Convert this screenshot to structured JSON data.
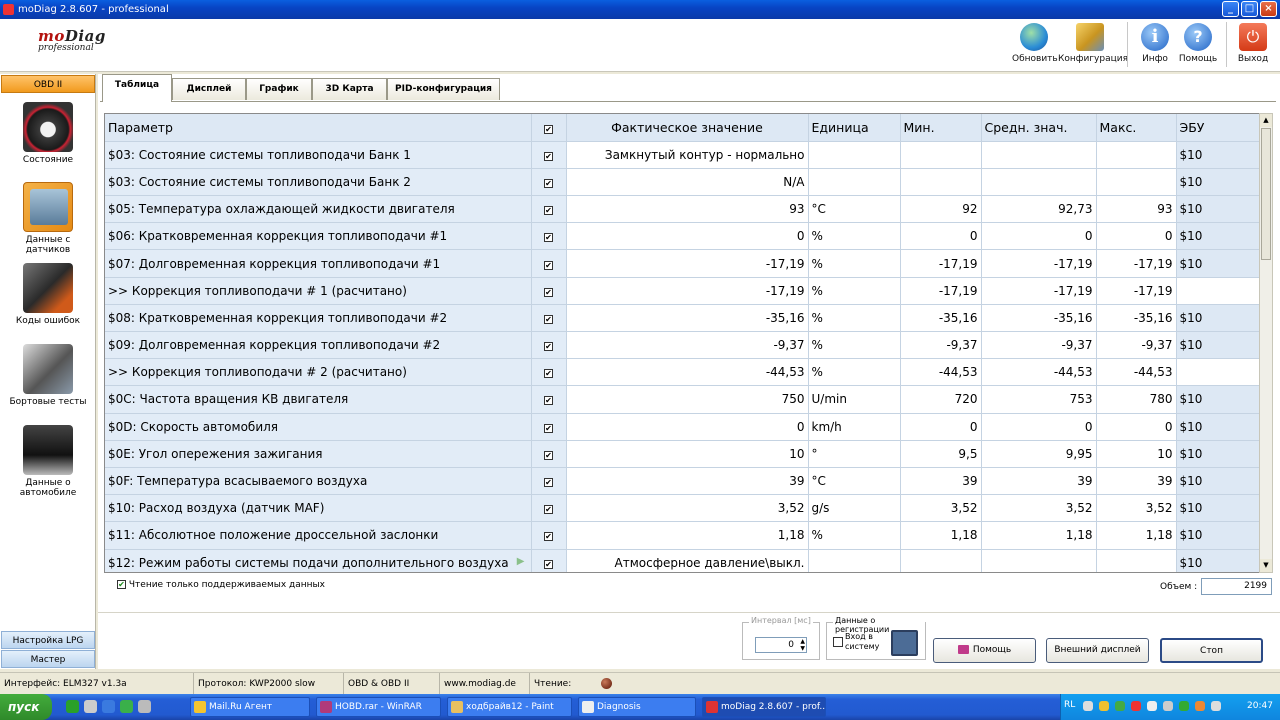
{
  "window": {
    "title": "moDiag 2.8.607 - professional",
    "min": "_",
    "max": "□",
    "close": "×"
  },
  "logo": {
    "brand_a": "mo",
    "brand_b": "Diag",
    "subtitle": "professional"
  },
  "toolbar": [
    {
      "label": "Обновить",
      "icon": "refresh-globe-icon"
    },
    {
      "label": "Конфигурация",
      "icon": "configuration-icon"
    },
    {
      "label": "Инфо",
      "icon": "info-icon"
    },
    {
      "label": "Помощь",
      "icon": "help-icon"
    },
    {
      "label": "Выход",
      "icon": "exit-power-icon"
    }
  ],
  "sidebar": {
    "header": "OBD II",
    "items": [
      {
        "label": "Состояние"
      },
      {
        "label": "Данные с датчиков"
      },
      {
        "label": "Коды ошибок"
      },
      {
        "label": "Бортовые тесты"
      },
      {
        "label_line1": "Данные о",
        "label_line2": "автомобиле"
      }
    ],
    "bottom": [
      "Настройка LPG",
      "Мастер"
    ]
  },
  "tabs": [
    "Таблица",
    "Дисплей",
    "График",
    "3D Карта",
    "PID-конфигурация"
  ],
  "table": {
    "headers": {
      "param": "Параметр",
      "check": "✔",
      "actual": "Фактическое значение",
      "unit": "Единица",
      "min": "Мин.",
      "avg": "Средн. знач.",
      "max": "Макс.",
      "ecu": "ЭБУ"
    },
    "rows": [
      {
        "param": "$03: Состояние системы топливоподачи Банк 1",
        "actual": "Замкнутый контур - нормально",
        "unit": "",
        "min": "",
        "avg": "",
        "max": "",
        "ecu": "$10"
      },
      {
        "param": "$03: Состояние системы топливоподачи Банк 2",
        "actual": "N/A",
        "unit": "",
        "min": "",
        "avg": "",
        "max": "",
        "ecu": "$10"
      },
      {
        "param": "$05: Температура охлаждающей жидкости двигателя",
        "actual": "93",
        "unit": "°C",
        "min": "92",
        "avg": "92,73",
        "max": "93",
        "ecu": "$10"
      },
      {
        "param": "$06: Кратковременная коррекция топливоподачи #1",
        "actual": "0",
        "unit": "%",
        "min": "0",
        "avg": "0",
        "max": "0",
        "ecu": "$10"
      },
      {
        "param": "$07: Долговременная коррекция топливоподачи #1",
        "actual": "-17,19",
        "unit": "%",
        "min": "-17,19",
        "avg": "-17,19",
        "max": "-17,19",
        "ecu": "$10"
      },
      {
        "param": ">> Коррекция топливоподачи # 1 (расчитано)",
        "actual": "-17,19",
        "unit": "%",
        "min": "-17,19",
        "avg": "-17,19",
        "max": "-17,19",
        "ecu": ""
      },
      {
        "param": "$08: Кратковременная коррекция топливоподачи #2",
        "actual": "-35,16",
        "unit": "%",
        "min": "-35,16",
        "avg": "-35,16",
        "max": "-35,16",
        "ecu": "$10"
      },
      {
        "param": "$09: Долговременная коррекция топливоподачи #2",
        "actual": "-9,37",
        "unit": "%",
        "min": "-9,37",
        "avg": "-9,37",
        "max": "-9,37",
        "ecu": "$10"
      },
      {
        "param": ">> Коррекция топливоподачи # 2 (расчитано)",
        "actual": "-44,53",
        "unit": "%",
        "min": "-44,53",
        "avg": "-44,53",
        "max": "-44,53",
        "ecu": ""
      },
      {
        "param": "$0C: Частота вращения КВ двигателя",
        "actual": "750",
        "unit": "U/min",
        "min": "720",
        "avg": "753",
        "max": "780",
        "ecu": "$10"
      },
      {
        "param": "$0D: Скорость автомобиля",
        "actual": "0",
        "unit": "km/h",
        "min": "0",
        "avg": "0",
        "max": "0",
        "ecu": "$10"
      },
      {
        "param": "$0E: Угол опережения зажигания",
        "actual": "10",
        "unit": "°",
        "min": "9,5",
        "avg": "9,95",
        "max": "10",
        "ecu": "$10"
      },
      {
        "param": "$0F: Температура всасываемого воздуха",
        "actual": "39",
        "unit": "°C",
        "min": "39",
        "avg": "39",
        "max": "39",
        "ecu": "$10"
      },
      {
        "param": "$10: Расход воздуха (датчик MAF)",
        "actual": "3,52",
        "unit": "g/s",
        "min": "3,52",
        "avg": "3,52",
        "max": "3,52",
        "ecu": "$10"
      },
      {
        "param": "$11: Абсолютное положение дроссельной заслонки",
        "actual": "1,18",
        "unit": "%",
        "min": "1,18",
        "avg": "1,18",
        "max": "1,18",
        "ecu": "$10"
      },
      {
        "param": "$12: Режим работы системы подачи дополнительного воздуха",
        "actual": "Атмосферное давление\\выкл.",
        "unit": "",
        "min": "",
        "avg": "",
        "max": "",
        "ecu": "$10"
      }
    ]
  },
  "options": {
    "supported_only": "Чтение  только поддерживаемых данных",
    "volume_label": "Объем :",
    "volume_value": "2199"
  },
  "interval": {
    "label": "Интервал [мс]",
    "value": "0"
  },
  "registration": {
    "label": "Данные о регистрации",
    "login_line1": "Вход в",
    "login_line2": "систему"
  },
  "buttons": {
    "help": "Помощь",
    "external": "Внешний дисплей",
    "stop": "Стоп"
  },
  "status": {
    "interface": "Интерфейс: ELM327 v1.3a",
    "protocol": "Протокол: KWP2000 slow",
    "mode": "OBD & OBD II",
    "site": "www.modiag.de",
    "reading": "Чтение:"
  },
  "taskbar": {
    "start": "пуск",
    "items": [
      "Mail.Ru Агент",
      "HOBD.rar - WinRAR",
      "ходбрайв12 - Paint",
      "Diagnosis",
      "moDiag 2.8.607 - prof..."
    ],
    "lang": "RL",
    "clock": "20:47"
  },
  "colors": {
    "accent_orange": "#f19a1e",
    "grid_blue": "#e2ecf7",
    "title_blue": "#0844c4"
  }
}
